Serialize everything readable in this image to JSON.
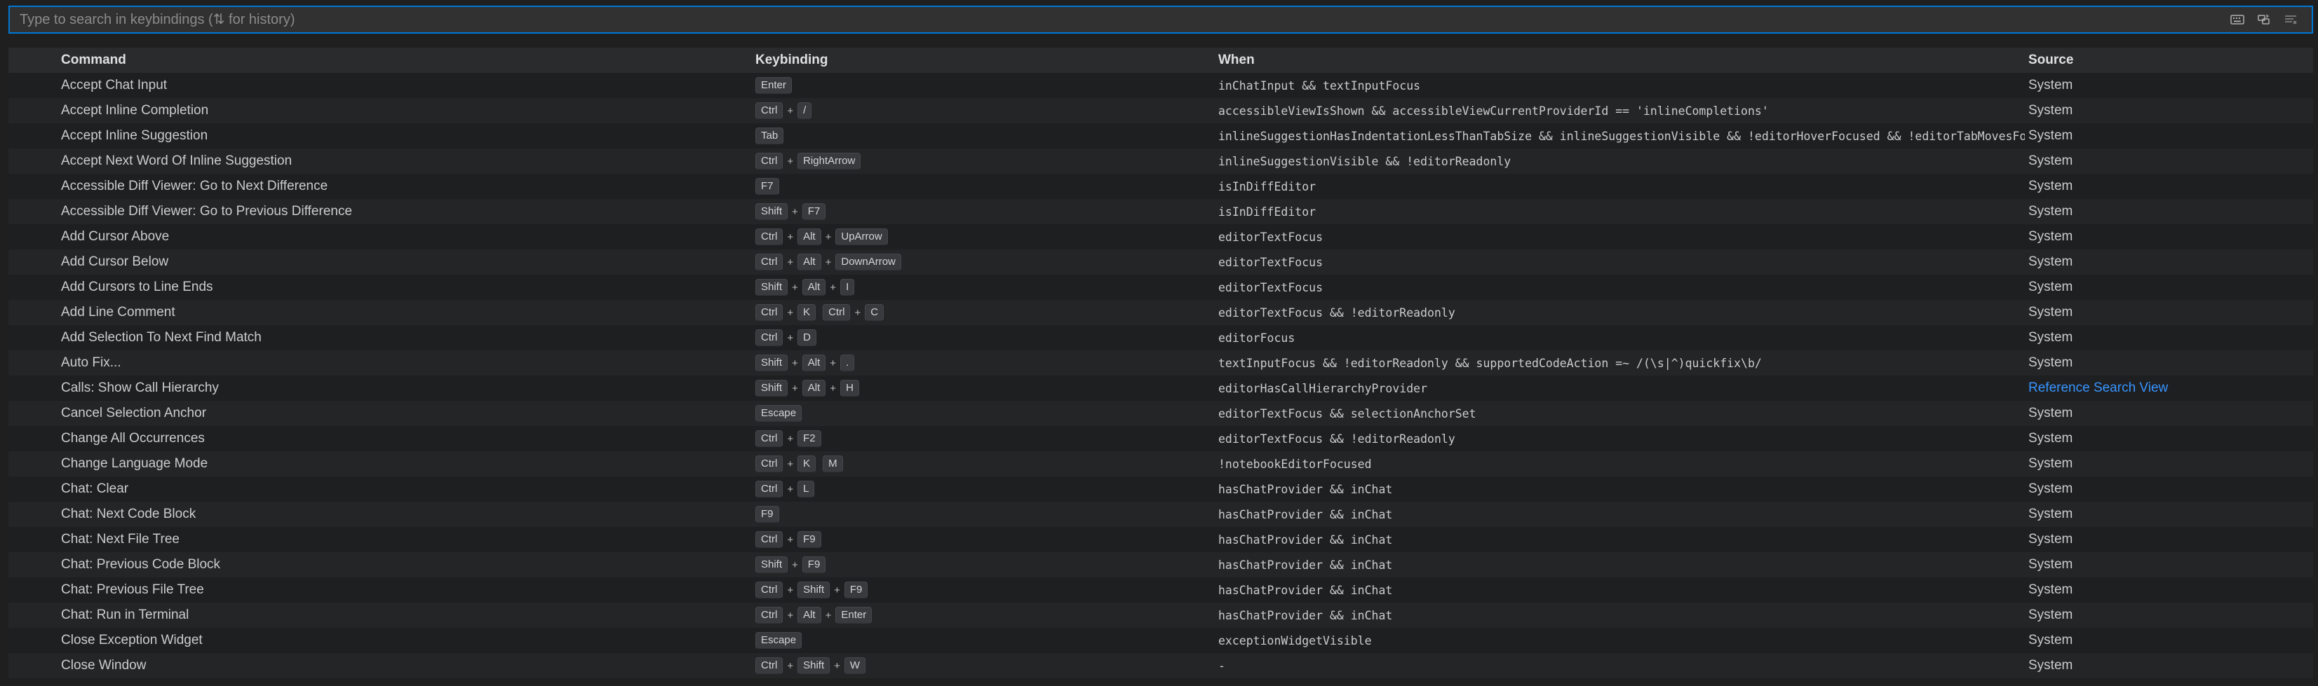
{
  "search": {
    "placeholder": "Type to search in keybindings (⇅ for history)",
    "value": ""
  },
  "search_actions": [
    {
      "icon": "keyboard-icon",
      "label": "Record Keys"
    },
    {
      "icon": "sort-precedence-icon",
      "label": "Sort by Precedence"
    },
    {
      "icon": "clear-filter-icon",
      "label": "Clear"
    }
  ],
  "columns": {
    "command": "Command",
    "keybinding": "Keybinding",
    "when": "When",
    "source": "Source"
  },
  "rows": [
    {
      "command": "Accept Chat Input",
      "keys": [
        [
          "Enter"
        ]
      ],
      "when": "inChatInput && textInputFocus",
      "source": "System"
    },
    {
      "command": "Accept Inline Completion",
      "keys": [
        [
          "Ctrl",
          "/"
        ]
      ],
      "when": "accessibleViewIsShown && accessibleViewCurrentProviderId == 'inlineCompletions'",
      "source": "System"
    },
    {
      "command": "Accept Inline Suggestion",
      "keys": [
        [
          "Tab"
        ]
      ],
      "when": "inlineSuggestionHasIndentationLessThanTabSize && inlineSuggestionVisible && !editorHoverFocused && !editorTabMovesFoc…",
      "source": "System"
    },
    {
      "command": "Accept Next Word Of Inline Suggestion",
      "keys": [
        [
          "Ctrl",
          "RightArrow"
        ]
      ],
      "when": "inlineSuggestionVisible && !editorReadonly",
      "source": "System"
    },
    {
      "command": "Accessible Diff Viewer: Go to Next Difference",
      "keys": [
        [
          "F7"
        ]
      ],
      "when": "isInDiffEditor",
      "source": "System"
    },
    {
      "command": "Accessible Diff Viewer: Go to Previous Difference",
      "keys": [
        [
          "Shift",
          "F7"
        ]
      ],
      "when": "isInDiffEditor",
      "source": "System"
    },
    {
      "command": "Add Cursor Above",
      "keys": [
        [
          "Ctrl",
          "Alt",
          "UpArrow"
        ]
      ],
      "when": "editorTextFocus",
      "source": "System"
    },
    {
      "command": "Add Cursor Below",
      "keys": [
        [
          "Ctrl",
          "Alt",
          "DownArrow"
        ]
      ],
      "when": "editorTextFocus",
      "source": "System"
    },
    {
      "command": "Add Cursors to Line Ends",
      "keys": [
        [
          "Shift",
          "Alt",
          "I"
        ]
      ],
      "when": "editorTextFocus",
      "source": "System"
    },
    {
      "command": "Add Line Comment",
      "keys": [
        [
          "Ctrl",
          "K"
        ],
        [
          "Ctrl",
          "C"
        ]
      ],
      "when": "editorTextFocus && !editorReadonly",
      "source": "System"
    },
    {
      "command": "Add Selection To Next Find Match",
      "keys": [
        [
          "Ctrl",
          "D"
        ]
      ],
      "when": "editorFocus",
      "source": "System"
    },
    {
      "command": "Auto Fix...",
      "keys": [
        [
          "Shift",
          "Alt",
          "."
        ]
      ],
      "when": "textInputFocus && !editorReadonly && supportedCodeAction =~ /(\\s|^)quickfix\\b/",
      "source": "System"
    },
    {
      "command": "Calls: Show Call Hierarchy",
      "keys": [
        [
          "Shift",
          "Alt",
          "H"
        ]
      ],
      "when": "editorHasCallHierarchyProvider",
      "source": "Reference Search View",
      "source_link": true
    },
    {
      "command": "Cancel Selection Anchor",
      "keys": [
        [
          "Escape"
        ]
      ],
      "when": "editorTextFocus && selectionAnchorSet",
      "source": "System"
    },
    {
      "command": "Change All Occurrences",
      "keys": [
        [
          "Ctrl",
          "F2"
        ]
      ],
      "when": "editorTextFocus && !editorReadonly",
      "source": "System"
    },
    {
      "command": "Change Language Mode",
      "keys": [
        [
          "Ctrl",
          "K"
        ],
        [
          "M"
        ]
      ],
      "when": "!notebookEditorFocused",
      "source": "System"
    },
    {
      "command": "Chat: Clear",
      "keys": [
        [
          "Ctrl",
          "L"
        ]
      ],
      "when": "hasChatProvider && inChat",
      "source": "System"
    },
    {
      "command": "Chat: Next Code Block",
      "keys": [
        [
          "F9"
        ]
      ],
      "when": "hasChatProvider && inChat",
      "source": "System"
    },
    {
      "command": "Chat: Next File Tree",
      "keys": [
        [
          "Ctrl",
          "F9"
        ]
      ],
      "when": "hasChatProvider && inChat",
      "source": "System"
    },
    {
      "command": "Chat: Previous Code Block",
      "keys": [
        [
          "Shift",
          "F9"
        ]
      ],
      "when": "hasChatProvider && inChat",
      "source": "System"
    },
    {
      "command": "Chat: Previous File Tree",
      "keys": [
        [
          "Ctrl",
          "Shift",
          "F9"
        ]
      ],
      "when": "hasChatProvider && inChat",
      "source": "System"
    },
    {
      "command": "Chat: Run in Terminal",
      "keys": [
        [
          "Ctrl",
          "Alt",
          "Enter"
        ]
      ],
      "when": "hasChatProvider && inChat",
      "source": "System"
    },
    {
      "command": "Close Exception Widget",
      "keys": [
        [
          "Escape"
        ]
      ],
      "when": "exceptionWidgetVisible",
      "source": "System"
    },
    {
      "command": "Close Window",
      "keys": [
        [
          "Ctrl",
          "Shift",
          "W"
        ]
      ],
      "when": "-",
      "source": "System"
    }
  ],
  "colors": {
    "background": "#1f1f1f",
    "focus_border": "#0078d4",
    "link": "#3794ff",
    "kbd_background": "#383a3e"
  }
}
